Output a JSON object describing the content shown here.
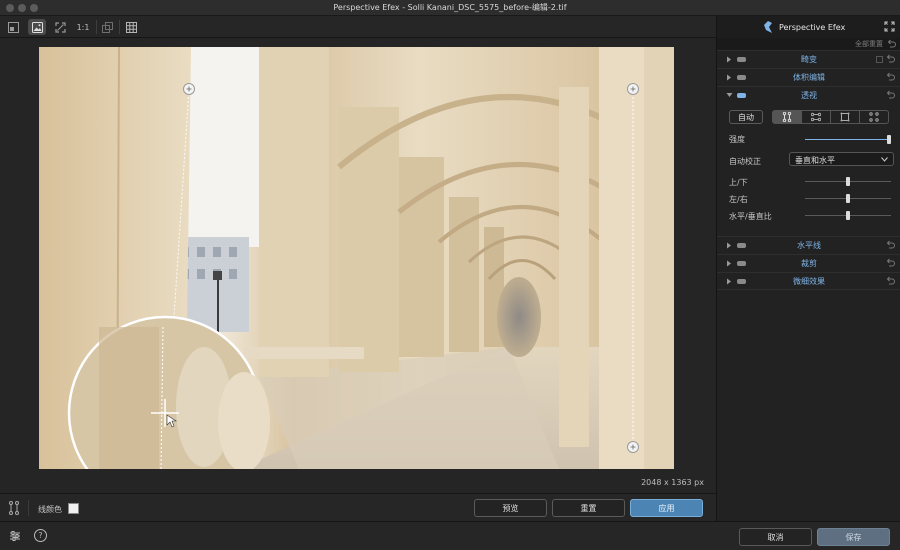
{
  "window": {
    "title": "Perspective Efex - Solli Kanani_DSC_5575_before-编辑-2.tif"
  },
  "toolbar": {
    "one_to_one_label": "1:1"
  },
  "canvas": {
    "image_size": "2048 x 1363 px"
  },
  "canvas_bar": {
    "line_color_label": "线颜色",
    "preview_label": "预览",
    "reset_label": "重置",
    "apply_label": "应用"
  },
  "panel": {
    "app_name": "Perspective Efex",
    "reset_all_label": "全部重置",
    "sections": {
      "distortion": "畸变",
      "volume": "体积编辑",
      "perspective": "透视",
      "horizon": "水平线",
      "crop": "裁剪",
      "finishing": "微细效果"
    },
    "perspective": {
      "auto_label": "自动",
      "strength_label": "强度",
      "strength_value": 1.0,
      "auto_correct_label": "自动校正",
      "auto_correct_value": "垂直和水平",
      "updown_label": "上/下",
      "updown_value": 0.5,
      "leftright_label": "左/右",
      "leftright_value": 0.5,
      "ratio_label": "水平/垂直比",
      "ratio_value": 0.5
    }
  },
  "bottom": {
    "cancel_label": "取消",
    "save_label": "保存"
  },
  "colors": {
    "accent_blue": "#4c85b3",
    "section_label_blue": "#7fb3e6"
  }
}
